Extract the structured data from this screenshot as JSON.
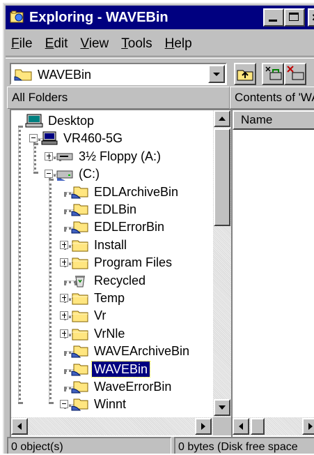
{
  "window": {
    "title": "Exploring - WAVEBin",
    "icon": "explorer-icon"
  },
  "menu": [
    {
      "label": "File",
      "key": "F",
      "rest": "ile"
    },
    {
      "label": "Edit",
      "key": "E",
      "rest": "dit"
    },
    {
      "label": "View",
      "key": "V",
      "rest": "iew"
    },
    {
      "label": "Tools",
      "key": "T",
      "rest": "ools"
    },
    {
      "label": "Help",
      "key": "H",
      "rest": "elp"
    }
  ],
  "address": {
    "value": "WAVEBin"
  },
  "panes": {
    "left_header": "All Folders",
    "right_header": "Contents of 'WA",
    "column_name": "Name"
  },
  "tree": [
    {
      "label": "Desktop",
      "icon": "desktop-icon",
      "level": 0,
      "expander": "none"
    },
    {
      "label": "VR460-5G",
      "icon": "computer-icon",
      "level": 1,
      "expander": "minus"
    },
    {
      "label": "3½ Floppy (A:)",
      "icon": "floppy-drive-icon",
      "level": 2,
      "expander": "plus"
    },
    {
      "label": "(C:)",
      "icon": "hard-drive-icon",
      "level": 2,
      "expander": "minus"
    },
    {
      "label": "EDLArchiveBin",
      "icon": "shared-folder-icon",
      "level": 3,
      "expander": "none"
    },
    {
      "label": "EDLBin",
      "icon": "shared-folder-icon",
      "level": 3,
      "expander": "none"
    },
    {
      "label": "EDLErrorBin",
      "icon": "shared-folder-icon",
      "level": 3,
      "expander": "none"
    },
    {
      "label": "Install",
      "icon": "folder-icon",
      "level": 3,
      "expander": "plus"
    },
    {
      "label": "Program Files",
      "icon": "folder-icon",
      "level": 3,
      "expander": "plus"
    },
    {
      "label": "Recycled",
      "icon": "recycle-bin-icon",
      "level": 3,
      "expander": "none"
    },
    {
      "label": "Temp",
      "icon": "folder-icon",
      "level": 3,
      "expander": "plus"
    },
    {
      "label": "Vr",
      "icon": "folder-icon",
      "level": 3,
      "expander": "plus"
    },
    {
      "label": "VrNle",
      "icon": "folder-icon",
      "level": 3,
      "expander": "plus"
    },
    {
      "label": "WAVEArchiveBin",
      "icon": "shared-folder-icon",
      "level": 3,
      "expander": "none"
    },
    {
      "label": "WAVEBin",
      "icon": "shared-folder-icon",
      "level": 3,
      "expander": "none",
      "selected": true
    },
    {
      "label": "WaveErrorBin",
      "icon": "shared-folder-icon",
      "level": 3,
      "expander": "none"
    },
    {
      "label": "Winnt",
      "icon": "shared-folder-icon",
      "level": 3,
      "expander": "minus"
    }
  ],
  "status": {
    "objects": "0 object(s)",
    "disk": "0 bytes (Disk free space"
  },
  "colors": {
    "titlebar": "#000080",
    "selection": "#000080",
    "face": "#c0c0c0",
    "folder": "#ffe680"
  }
}
